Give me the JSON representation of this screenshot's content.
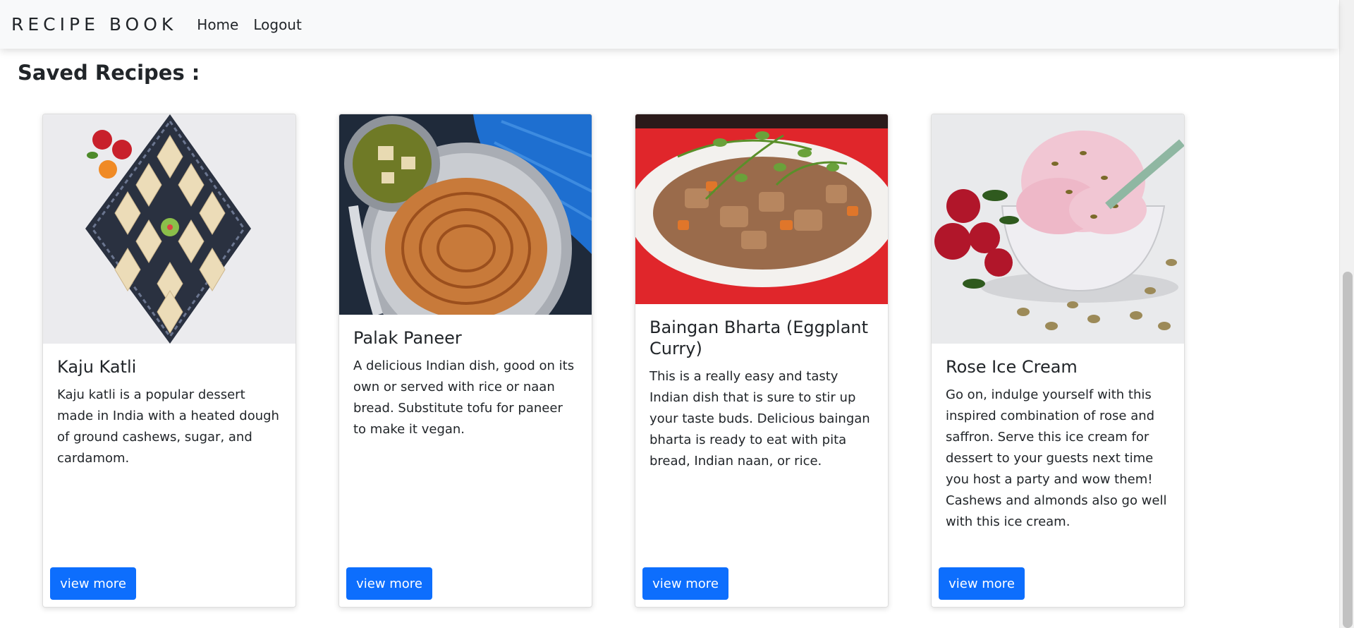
{
  "nav": {
    "brand": "RECIPE BOOK",
    "links": [
      "Home",
      "Logout"
    ]
  },
  "page": {
    "title": "Saved Recipes :"
  },
  "recipes": [
    {
      "title": "Kaju Katli",
      "description": "Kaju katli is a popular dessert made in India with a heated dough of ground cashews, sugar, and cardamom.",
      "button": "view more"
    },
    {
      "title": "Palak Paneer",
      "description": "A delicious Indian dish, good on its own or served with rice or naan bread. Substitute tofu for paneer to make it vegan.",
      "button": "view more"
    },
    {
      "title": "Baingan Bharta (Eggplant Curry)",
      "description": "This is a really easy and tasty Indian dish that is sure to stir up your taste buds. Delicious baingan bharta is ready to eat with pita bread, Indian naan, or rice.",
      "button": "view more"
    },
    {
      "title": "Rose Ice Cream",
      "description": "Go on, indulge yourself with this inspired combination of rose and saffron. Serve this ice cream for dessert to your guests next time you host a party and wow them! Cashews and almonds also go well with this ice cream.",
      "button": "view more"
    }
  ],
  "colors": {
    "primary": "#0d6efd",
    "navbar_bg": "#f8f9fa",
    "text": "#212529"
  }
}
